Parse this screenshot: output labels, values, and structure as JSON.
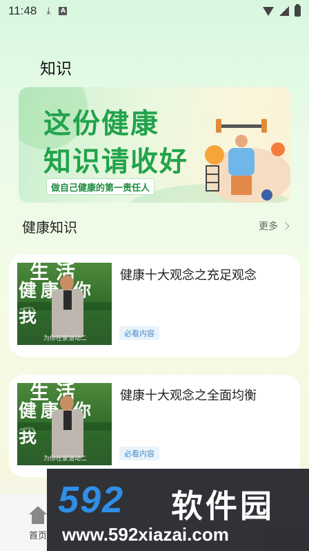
{
  "status_bar": {
    "time": "11:48",
    "icons": [
      "download-icon",
      "a-app-icon",
      "wifi-icon",
      "signal-icon",
      "battery-icon"
    ]
  },
  "page": {
    "title": "知识"
  },
  "banner": {
    "headline_line1": "这份健康",
    "headline_line2": "知识请收好",
    "tagline": "做自己健康的第一责任人",
    "accent_color": "#22a34b"
  },
  "section": {
    "title": "健康知识",
    "more_label": "更多"
  },
  "articles": [
    {
      "title": "健康十大观念之充足观念",
      "tag": "必看内容",
      "thumb_text_top": "生活",
      "thumb_text_mid": "健康 你我",
      "thumb_caption": "为你在家请动二"
    },
    {
      "title": "健康十大观念之全面均衡",
      "tag": "必看内容",
      "thumb_text_top": "生活",
      "thumb_text_mid": "健康 你我",
      "thumb_caption": "为你在家请动二"
    }
  ],
  "bottom_nav": {
    "home_label": "首页"
  },
  "watermark": {
    "logo": "592",
    "brand": "软件园",
    "url": "www.592xiazai.com"
  }
}
